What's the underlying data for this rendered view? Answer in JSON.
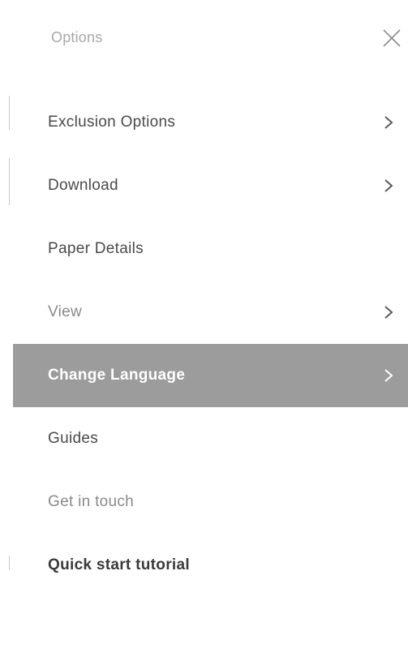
{
  "panel": {
    "title": "Options"
  },
  "menu": {
    "items": [
      {
        "label": "Exclusion Options",
        "has_submenu": true,
        "active": false
      },
      {
        "label": "Download",
        "has_submenu": true,
        "active": false
      },
      {
        "label": "Paper Details",
        "has_submenu": false,
        "active": false
      },
      {
        "label": "View",
        "has_submenu": true,
        "active": false
      },
      {
        "label": "Change Language",
        "has_submenu": true,
        "active": true
      },
      {
        "label": "Guides",
        "has_submenu": false,
        "active": false
      },
      {
        "label": "Get in touch",
        "has_submenu": false,
        "active": false
      },
      {
        "label": "Quick start tutorial",
        "has_submenu": false,
        "active": false
      }
    ]
  },
  "icons": {
    "close": "close-icon",
    "submenu": "chevron-right-icon"
  },
  "colors": {
    "active_background": "#9c9c9c",
    "active_text": "#ffffff",
    "text": "#4a4a4a",
    "muted_text": "#8a8a8a",
    "title_text": "#a8a8a8"
  }
}
